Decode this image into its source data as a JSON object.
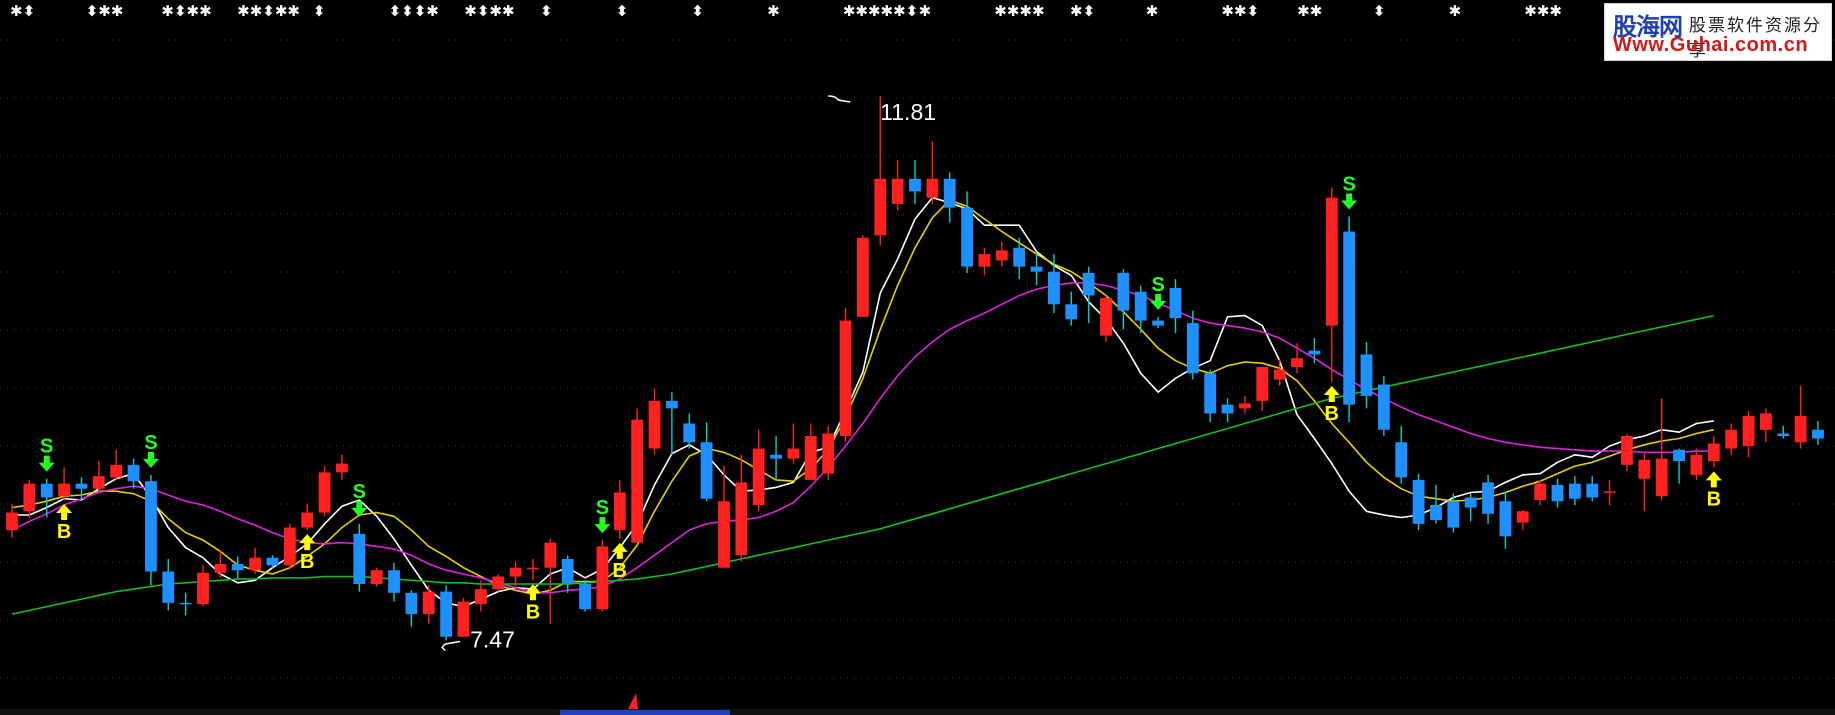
{
  "colors": {
    "background": "#000000",
    "up_candle": "#ff2020",
    "down_candle": "#1e90ff",
    "wick": "#00d0d0",
    "ma_white": "#ffffff",
    "ma_yellow": "#e8d000",
    "ma_magenta": "#e020e0",
    "ma_green": "#10c020",
    "sell_signal": "#20ff20",
    "buy_signal": "#ffff00",
    "grid": "#3a3a3a",
    "top_markers": "#ffffff"
  },
  "watermark": {
    "brand": "股海网",
    "tagline": "股票软件资源分享",
    "url": "Www.Guhai.com.cn"
  },
  "top_marker_strip": {
    "groups": [
      "✱⬍",
      "⬍✱✱",
      "✱⬍✱✱",
      "✱✱⬍✱✱",
      "⬍",
      "⬍⬍⬍✱",
      "✱⬍✱✱",
      "⬍",
      "⬍",
      "⬍",
      "✱",
      "✱✱✱✱✱⬍",
      "✱",
      "✱✱✱✱",
      "✱⬍",
      "✱",
      "✱✱⬍",
      "✱✱",
      "⬍",
      "✱",
      "✱✱✱"
    ]
  },
  "chart_data": {
    "type": "candlestick",
    "ylim": [
      6.9,
      12.4
    ],
    "grid": "horizontal dotted",
    "annotations": {
      "high": {
        "label": "11.81",
        "value": 11.81,
        "index": 47
      },
      "low": {
        "label": "7.47",
        "value": 7.47,
        "index": 25
      }
    },
    "candles": [
      [
        8.35,
        8.49,
        8.56,
        8.29
      ],
      [
        8.5,
        8.72,
        8.75,
        8.45
      ],
      [
        8.72,
        8.61,
        8.76,
        8.45
      ],
      [
        8.62,
        8.72,
        8.85,
        8.59
      ],
      [
        8.72,
        8.68,
        8.77,
        8.6
      ],
      [
        8.68,
        8.78,
        8.9,
        8.65
      ],
      [
        8.77,
        8.87,
        8.99,
        8.75
      ],
      [
        8.87,
        8.74,
        8.92,
        8.68
      ],
      [
        8.74,
        8.02,
        8.79,
        7.91
      ],
      [
        8.02,
        7.77,
        8.12,
        7.71
      ],
      [
        7.77,
        7.76,
        7.85,
        7.67
      ],
      [
        7.76,
        8.01,
        8.07,
        7.74
      ],
      [
        8.01,
        8.08,
        8.19,
        7.97
      ],
      [
        8.08,
        8.03,
        8.14,
        7.96
      ],
      [
        8.03,
        8.13,
        8.21,
        8.0
      ],
      [
        8.13,
        8.07,
        8.15,
        8.05
      ],
      [
        8.07,
        8.37,
        8.4,
        8.04
      ],
      [
        8.37,
        8.49,
        8.56,
        8.35
      ],
      [
        8.49,
        8.81,
        8.86,
        8.46
      ],
      [
        8.81,
        8.88,
        8.95,
        8.75
      ],
      [
        8.32,
        7.92,
        8.4,
        7.86
      ],
      [
        7.92,
        8.03,
        8.05,
        7.9
      ],
      [
        8.03,
        7.85,
        8.09,
        7.78
      ],
      [
        7.85,
        7.68,
        7.87,
        7.58
      ],
      [
        7.68,
        7.86,
        7.91,
        7.6
      ],
      [
        7.86,
        7.5,
        7.91,
        7.47
      ],
      [
        7.5,
        7.78,
        7.81,
        7.62
      ],
      [
        7.76,
        7.88,
        7.95,
        7.7
      ],
      [
        7.88,
        7.98,
        8.0,
        7.86
      ],
      [
        7.98,
        8.05,
        8.1,
        7.9
      ],
      [
        8.05,
        8.05,
        8.12,
        7.95
      ],
      [
        8.05,
        8.25,
        8.28,
        7.6
      ],
      [
        8.12,
        7.92,
        8.15,
        7.85
      ],
      [
        7.92,
        7.72,
        7.95,
        7.7
      ],
      [
        7.72,
        8.22,
        8.27,
        7.7
      ],
      [
        8.35,
        8.65,
        8.75,
        8.28
      ],
      [
        8.25,
        9.23,
        9.32,
        8.95
      ],
      [
        9.0,
        9.38,
        9.48,
        8.95
      ],
      [
        9.38,
        9.32,
        9.45,
        8.95
      ],
      [
        9.2,
        9.05,
        9.28,
        9.0
      ],
      [
        9.05,
        8.6,
        9.21,
        8.58
      ],
      [
        8.05,
        8.58,
        8.86,
        8.07
      ],
      [
        8.15,
        8.73,
        8.95,
        8.1
      ],
      [
        8.55,
        9.0,
        9.15,
        8.5
      ],
      [
        8.95,
        8.92,
        9.1,
        8.75
      ],
      [
        8.92,
        9.0,
        9.2,
        8.88
      ],
      [
        8.75,
        9.1,
        9.2,
        8.75
      ],
      [
        8.8,
        9.12,
        9.18,
        8.75
      ],
      [
        9.1,
        10.02,
        10.12,
        9.05
      ],
      [
        10.05,
        10.68,
        10.7,
        10.1
      ],
      [
        10.7,
        11.15,
        11.81,
        10.62
      ],
      [
        10.95,
        11.15,
        11.3,
        10.9
      ],
      [
        11.15,
        11.05,
        11.3,
        10.95
      ],
      [
        11.0,
        11.15,
        11.45,
        10.95
      ],
      [
        11.15,
        10.92,
        11.2,
        10.8
      ],
      [
        10.92,
        10.45,
        11.05,
        10.4
      ],
      [
        10.45,
        10.55,
        10.6,
        10.38
      ],
      [
        10.5,
        10.58,
        10.65,
        10.45
      ],
      [
        10.6,
        10.45,
        10.68,
        10.35
      ],
      [
        10.45,
        10.41,
        10.55,
        10.3
      ],
      [
        10.41,
        10.15,
        10.55,
        10.08
      ],
      [
        10.15,
        10.03,
        10.25,
        9.98
      ],
      [
        10.4,
        10.22,
        10.45,
        10.0
      ],
      [
        9.9,
        10.2,
        10.22,
        9.85
      ],
      [
        10.4,
        10.1,
        10.43,
        9.95
      ],
      [
        10.25,
        10.02,
        10.3,
        9.92
      ],
      [
        10.02,
        9.98,
        10.05,
        9.96
      ],
      [
        10.28,
        10.04,
        10.35,
        9.92
      ],
      [
        10.0,
        9.6,
        10.1,
        9.55
      ],
      [
        9.6,
        9.28,
        9.63,
        9.21
      ],
      [
        9.35,
        9.28,
        9.4,
        9.21
      ],
      [
        9.32,
        9.36,
        9.42,
        9.28
      ],
      [
        9.38,
        9.65,
        9.65,
        9.3
      ],
      [
        9.55,
        9.63,
        9.71,
        9.5
      ],
      [
        9.65,
        9.72,
        9.84,
        9.6
      ],
      [
        9.78,
        9.75,
        9.88,
        9.68
      ],
      [
        9.98,
        11.0,
        11.08,
        9.53
      ],
      [
        10.73,
        9.35,
        10.85,
        9.21
      ],
      [
        9.75,
        9.42,
        9.85,
        9.32
      ],
      [
        9.51,
        9.15,
        9.58,
        9.1
      ],
      [
        9.05,
        8.77,
        9.18,
        8.72
      ],
      [
        8.75,
        8.4,
        8.8,
        8.35
      ],
      [
        8.55,
        8.43,
        8.71,
        8.4
      ],
      [
        8.58,
        8.37,
        8.64,
        8.33
      ],
      [
        8.61,
        8.53,
        8.64,
        8.42
      ],
      [
        8.73,
        8.48,
        8.79,
        8.4
      ],
      [
        8.58,
        8.3,
        8.66,
        8.2
      ],
      [
        8.41,
        8.5,
        8.51,
        8.35
      ],
      [
        8.59,
        8.72,
        8.75,
        8.55
      ],
      [
        8.71,
        8.58,
        8.76,
        8.53
      ],
      [
        8.72,
        8.6,
        8.78,
        8.55
      ],
      [
        8.72,
        8.61,
        8.78,
        8.58
      ],
      [
        8.66,
        8.66,
        8.75,
        8.55
      ],
      [
        8.87,
        9.1,
        9.12,
        8.82
      ],
      [
        8.76,
        8.91,
        8.97,
        8.5
      ],
      [
        8.62,
        8.92,
        9.4,
        8.59
      ],
      [
        8.99,
        8.9,
        9.0,
        8.72
      ],
      [
        8.79,
        8.95,
        9.0,
        8.75
      ],
      [
        8.9,
        9.04,
        9.1,
        8.85
      ],
      [
        9.0,
        9.15,
        9.2,
        8.95
      ],
      [
        9.02,
        9.26,
        9.3,
        8.93
      ],
      [
        9.15,
        9.28,
        9.32,
        9.05
      ],
      [
        9.12,
        9.1,
        9.18,
        9.08
      ],
      [
        9.05,
        9.26,
        9.5,
        9.0
      ],
      [
        9.15,
        9.08,
        9.22,
        9.03
      ]
    ],
    "series": [
      {
        "color": "white",
        "values": [
          8.47,
          8.47,
          8.53,
          8.6,
          8.59,
          8.68,
          8.76,
          8.8,
          8.61,
          8.37,
          8.21,
          8.13,
          8.0,
          7.93,
          7.95,
          8.05,
          8.14,
          8.24,
          8.4,
          8.54,
          8.59,
          8.46,
          8.28,
          8.07,
          7.87,
          7.77,
          7.74,
          7.8,
          7.86,
          7.89,
          7.88,
          8.0,
          8.05,
          7.97,
          8.04,
          8.21,
          8.4,
          8.71,
          8.96,
          9.03,
          8.95,
          8.79,
          8.66,
          8.67,
          8.69,
          8.73,
          8.97,
          9.01,
          9.3,
          9.61,
          10.24,
          10.51,
          10.83,
          11.0,
          10.96,
          10.91,
          10.78,
          10.78,
          10.78,
          10.57,
          10.46,
          10.38,
          10.17,
          10.03,
          9.84,
          9.6,
          9.45,
          9.56,
          9.64,
          9.7,
          10.05,
          10.06,
          9.98,
          9.7,
          9.27,
          9.08,
          8.88,
          8.66,
          8.5,
          8.47,
          8.45,
          8.47,
          8.53,
          8.61,
          8.65,
          8.66,
          8.73,
          8.79,
          8.8,
          8.89,
          8.95,
          8.93,
          9.02,
          9.07,
          9.1,
          9.15,
          9.13,
          9.2,
          9.22
        ]
      },
      {
        "color": "yellow",
        "values": [
          8.53,
          8.55,
          8.58,
          8.62,
          8.63,
          8.66,
          8.66,
          8.64,
          8.58,
          8.44,
          8.33,
          8.27,
          8.18,
          8.07,
          8.03,
          8.0,
          8.05,
          8.14,
          8.24,
          8.37,
          8.47,
          8.49,
          8.46,
          8.35,
          8.22,
          8.14,
          8.05,
          7.98,
          7.91,
          7.87,
          7.84,
          7.87,
          7.94,
          7.94,
          7.94,
          8.05,
          8.23,
          8.5,
          8.74,
          8.94,
          9.0,
          8.97,
          8.91,
          8.83,
          8.75,
          8.74,
          8.84,
          8.99,
          9.25,
          9.56,
          9.95,
          10.3,
          10.6,
          10.84,
          10.98,
          10.93,
          10.83,
          10.73,
          10.64,
          10.55,
          10.47,
          10.41,
          10.32,
          10.22,
          10.09,
          9.95,
          9.8,
          9.7,
          9.64,
          9.6,
          9.66,
          9.69,
          9.68,
          9.64,
          9.54,
          9.38,
          9.2,
          9.05,
          8.89,
          8.77,
          8.68,
          8.62,
          8.6,
          8.58,
          8.59,
          8.61,
          8.65,
          8.7,
          8.74,
          8.8,
          8.86,
          8.89,
          8.94,
          8.99,
          9.03,
          9.06,
          9.08,
          9.12,
          9.15
        ]
      },
      {
        "color": "magenta",
        "values": [
          8.35,
          8.42,
          8.48,
          8.55,
          8.6,
          8.65,
          8.68,
          8.7,
          8.68,
          8.63,
          8.58,
          8.55,
          8.5,
          8.44,
          8.39,
          8.33,
          8.28,
          8.25,
          8.24,
          8.25,
          8.24,
          8.22,
          8.2,
          8.15,
          8.08,
          8.03,
          8.0,
          7.97,
          7.93,
          7.89,
          7.85,
          7.85,
          7.87,
          7.88,
          7.9,
          7.96,
          8.05,
          8.15,
          8.25,
          8.35,
          8.4,
          8.42,
          8.43,
          8.45,
          8.5,
          8.57,
          8.7,
          8.85,
          9.02,
          9.2,
          9.4,
          9.58,
          9.73,
          9.85,
          9.95,
          10.02,
          10.08,
          10.15,
          10.22,
          10.27,
          10.3,
          10.32,
          10.32,
          10.3,
          10.26,
          10.22,
          10.16,
          10.1,
          10.04,
          10.0,
          9.98,
          9.96,
          9.93,
          9.88,
          9.8,
          9.72,
          9.63,
          9.55,
          9.47,
          9.4,
          9.33,
          9.27,
          9.22,
          9.17,
          9.12,
          9.08,
          9.05,
          9.03,
          9.01,
          9.0,
          8.99,
          8.98,
          8.98,
          8.98,
          8.97,
          8.97,
          8.97,
          8.98,
          8.98
        ]
      },
      {
        "color": "green",
        "values": [
          7.68,
          7.71,
          7.74,
          7.77,
          7.8,
          7.83,
          7.86,
          7.88,
          7.9,
          7.92,
          7.93,
          7.94,
          7.95,
          7.96,
          7.96,
          7.97,
          7.97,
          7.97,
          7.98,
          7.98,
          7.98,
          7.97,
          7.96,
          7.95,
          7.94,
          7.93,
          7.93,
          7.92,
          7.92,
          7.92,
          7.92,
          7.92,
          7.92,
          7.93,
          7.94,
          7.95,
          7.96,
          7.98,
          8.0,
          8.03,
          8.06,
          8.09,
          8.12,
          8.15,
          8.18,
          8.21,
          8.24,
          8.27,
          8.3,
          8.33,
          8.36,
          8.4,
          8.44,
          8.48,
          8.52,
          8.56,
          8.6,
          8.64,
          8.68,
          8.72,
          8.76,
          8.8,
          8.84,
          8.88,
          8.92,
          8.96,
          9.0,
          9.04,
          9.08,
          9.12,
          9.16,
          9.2,
          9.24,
          9.28,
          9.32,
          9.36,
          9.4,
          9.43,
          9.46,
          9.49,
          9.52,
          9.55,
          9.58,
          9.61,
          9.64,
          9.67,
          9.7,
          9.73,
          9.76,
          9.79,
          9.82,
          9.85,
          9.88,
          9.91,
          9.94,
          9.97,
          10.0,
          10.03,
          10.06
        ]
      }
    ],
    "signals": [
      {
        "type": "S",
        "index": 2
      },
      {
        "type": "B",
        "index": 3
      },
      {
        "type": "S",
        "index": 8
      },
      {
        "type": "B",
        "index": 17
      },
      {
        "type": "S",
        "index": 20
      },
      {
        "type": "B",
        "index": 30
      },
      {
        "type": "S",
        "index": 34
      },
      {
        "type": "B",
        "index": 35
      },
      {
        "type": "S",
        "index": 66
      },
      {
        "type": "B",
        "index": 76
      },
      {
        "type": "S",
        "index": 77
      },
      {
        "type": "B",
        "index": 98
      }
    ]
  }
}
